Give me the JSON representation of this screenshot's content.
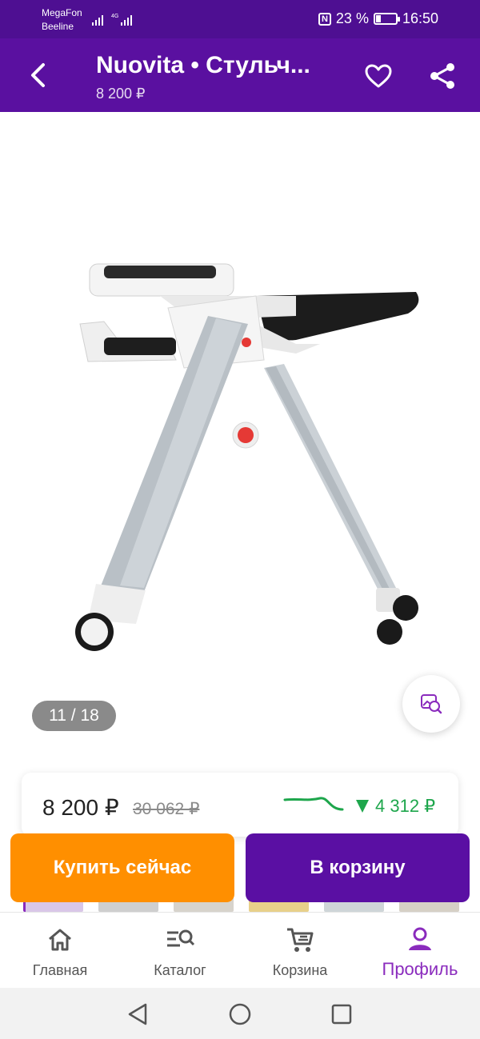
{
  "status_bar": {
    "carrier_1": "MegaFon",
    "carrier_2": "Beeline",
    "network": "4G",
    "battery_percent": "23 %",
    "battery_level": 0.23,
    "time": "16:50"
  },
  "app_bar": {
    "title": "Nuovita • Стульч...",
    "subtitle": "8 200 ₽"
  },
  "gallery": {
    "counter": "11 / 18",
    "image_subject": "highchair"
  },
  "price": {
    "current": "8 200 ₽",
    "old": "30 062 ₽",
    "drop": "4 312 ₽",
    "drop_color": "#1ea64c"
  },
  "actions": {
    "buy_now": "Купить сейчас",
    "to_cart": "В корзину",
    "buy_color": "#ff8f00",
    "cart_color": "#5a0fa3"
  },
  "bottom_nav": {
    "items": [
      {
        "label": "Главная",
        "icon": "home-icon"
      },
      {
        "label": "Каталог",
        "icon": "catalog-search-icon"
      },
      {
        "label": "Корзина",
        "icon": "cart-icon"
      },
      {
        "label": "Профиль",
        "icon": "profile-icon",
        "active": true
      }
    ],
    "accent": "#8a2bbd"
  },
  "system_nav": {
    "icons": [
      "back-triangle-icon",
      "home-circle-icon",
      "recents-square-icon"
    ]
  }
}
